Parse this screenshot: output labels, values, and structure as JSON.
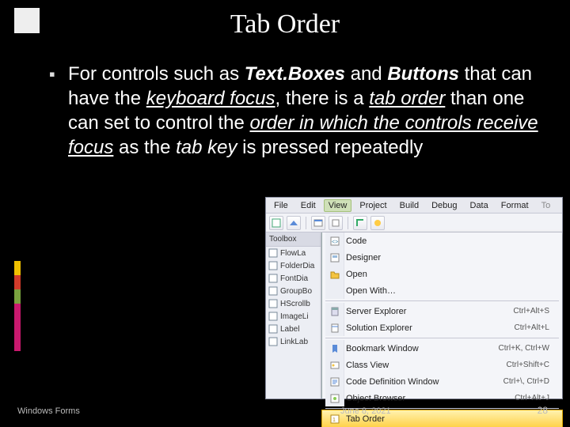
{
  "title": "Tab Order",
  "bullet_html": "For controls such as <span class=\"ib\">Text.Boxes</span> and <span class=\"ib\">Buttons</span> that can have the <span class=\"iu\">keyboard focus</span>, there is a <span class=\"iu\">tab order</span> than one can set to control the <span class=\"iu\">order in which the controls receive focus</span> as the <i>tab key</i> is pressed repeatedly",
  "footer": {
    "left": "Windows Forms",
    "date": "June 8, 2021",
    "page": "28"
  },
  "left_stripe": [
    {
      "h": 18,
      "c": "#f0c000"
    },
    {
      "h": 18,
      "c": "#d23b2b"
    },
    {
      "h": 18,
      "c": "#7aa23f"
    },
    {
      "h": 60,
      "c": "#c9196e"
    }
  ],
  "vs": {
    "menubar": [
      "File",
      "Edit",
      "View",
      "Project",
      "Build",
      "Debug",
      "Data",
      "Format"
    ],
    "menubar_trailing": "To",
    "menubar_selected_index": 2,
    "toolbox_header": "Toolbox",
    "toolbox_items": [
      "FlowLa",
      "FolderDia",
      "FontDia",
      "GroupBo",
      "HScrollb",
      "ImageLi",
      "Label",
      "LinkLab"
    ],
    "dropdown": [
      {
        "label": "Code",
        "icon": "code"
      },
      {
        "label": "Designer",
        "icon": "designer"
      },
      {
        "label": "Open",
        "icon": "open"
      },
      {
        "label": "Open With…",
        "icon": ""
      },
      {
        "sep": true
      },
      {
        "label": "Server Explorer",
        "shortcut": "Ctrl+Alt+S",
        "icon": "server"
      },
      {
        "label": "Solution Explorer",
        "shortcut": "Ctrl+Alt+L",
        "icon": "solution"
      },
      {
        "sep": true
      },
      {
        "label": "Bookmark Window",
        "shortcut": "Ctrl+K, Ctrl+W",
        "icon": "bookmark"
      },
      {
        "label": "Class View",
        "shortcut": "Ctrl+Shift+C",
        "icon": "class"
      },
      {
        "label": "Code Definition Window",
        "shortcut": "Ctrl+\\, Ctrl+D",
        "icon": "codedef"
      },
      {
        "label": "Object Browser",
        "shortcut": "Ctrl+Alt+J",
        "icon": "object"
      },
      {
        "sep": true
      },
      {
        "label": "Tab Order",
        "icon": "taborder",
        "hover": true
      }
    ]
  }
}
